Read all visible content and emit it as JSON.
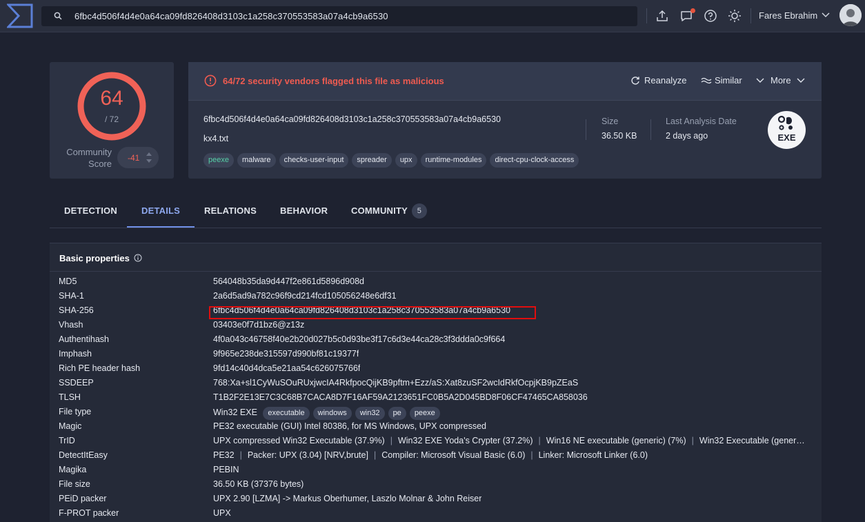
{
  "header": {
    "search_query": "6fbc4d506f4d4e0a64ca09fd826408d3103c1a258c370553583a07a4cb9a6530",
    "icons": [
      "search-icon",
      "upload-icon",
      "chat-icon",
      "help-icon",
      "theme-icon",
      "chevron-down-icon"
    ],
    "user_name": "Fares Ebrahim"
  },
  "score": {
    "detections": "64",
    "total": "/ 72",
    "community_label_line1": "Community",
    "community_label_line2": "Score",
    "community_value": "-41"
  },
  "summary": {
    "alert_text": "64/72 security vendors flagged this file as malicious",
    "actions": {
      "reanalyze": "Reanalyze",
      "similar": "Similar",
      "more": "More"
    },
    "hash": "6fbc4d506f4d4e0a64ca09fd826408d3103c1a258c370553583a07a4cb9a6530",
    "filename": "kx4.txt",
    "tags": [
      "peexe",
      "malware",
      "checks-user-input",
      "spreader",
      "upx",
      "runtime-modules",
      "direct-cpu-clock-access"
    ],
    "size_label": "Size",
    "size_value": "36.50 KB",
    "date_label": "Last Analysis Date",
    "date_value": "2 days ago",
    "file_type_badge": "EXE"
  },
  "tabs": [
    {
      "label": "DETECTION"
    },
    {
      "label": "DETAILS"
    },
    {
      "label": "RELATIONS"
    },
    {
      "label": "BEHAVIOR"
    },
    {
      "label": "COMMUNITY",
      "count": "5"
    }
  ],
  "details": {
    "section_title": "Basic properties",
    "properties": [
      {
        "key": "MD5",
        "value": "564048b35da9d447f2e861d5896d908d"
      },
      {
        "key": "SHA-1",
        "value": "2a6d5ad9a782c96f9cd214fcd105056248e6df31"
      },
      {
        "key": "SHA-256",
        "value": "6fbc4d506f4d4e0a64ca09fd826408d3103c1a258c370553583a07a4cb9a6530"
      },
      {
        "key": "Vhash",
        "value": "03403e0f7d1bz6@z13z"
      },
      {
        "key": "Authentihash",
        "value": "4f0a043c46758f40e2b20d027b5c0d93be3f17c6d3e44ca28c3f3ddda0c9f664"
      },
      {
        "key": "Imphash",
        "value": "9f965e238de315597d990bf81c19377f"
      },
      {
        "key": "Rich PE header hash",
        "value": "9fd14c40d4dca5e21aa54c626075766f"
      },
      {
        "key": "SSDEEP",
        "value": "768:Xa+sl1CyWuSOuRUxjwcIA4RkfpocQijKB9pftm+Ezz/aS:Xat8zuSF2wcIdRkfOcpjKB9pZEaS"
      },
      {
        "key": "TLSH",
        "value": "T1B2F2E13E7C3C68B7CACA8D7F16AF59A2123651FC0B5A2D045BD8F06CF47465CA858036"
      },
      {
        "key": "File type",
        "value": "Win32 EXE",
        "pills": [
          "executable",
          "windows",
          "win32",
          "pe",
          "peexe"
        ]
      },
      {
        "key": "Magic",
        "value": "PE32 executable (GUI) Intel 80386, for MS Windows, UPX compressed"
      },
      {
        "key": "TrID",
        "segments": [
          "UPX compressed Win32 Executable (37.9%)",
          "Win32 EXE Yoda's Crypter (37.2%)",
          "Win16 NE executable (generic) (7%)",
          "Win32 Executable (gener…"
        ]
      },
      {
        "key": "DetectItEasy",
        "segments": [
          "PE32",
          "Packer: UPX (3.04) [NRV,brute]",
          "Compiler: Microsoft Visual Basic (6.0)",
          "Linker: Microsoft Linker (6.0)"
        ]
      },
      {
        "key": "Magika",
        "value": "PEBIN"
      },
      {
        "key": "File size",
        "value": "36.50 KB (37376 bytes)"
      },
      {
        "key": "PEiD packer",
        "value": "UPX 2.90 [LZMA] -> Markus Oberhumer, Laszlo Molnar & John Reiser"
      },
      {
        "key": "F-PROT packer",
        "value": "UPX"
      }
    ]
  }
}
